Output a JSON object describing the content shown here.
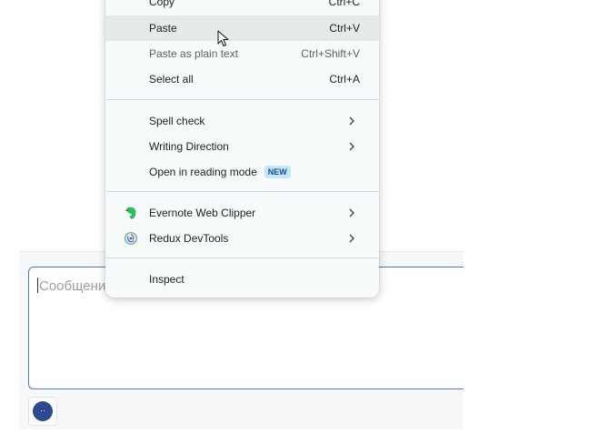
{
  "composer": {
    "placeholder": "Сообщени",
    "emoji_button_glyph": "··"
  },
  "context_menu": {
    "copy": {
      "label": "Copy",
      "shortcut": "Ctrl+C"
    },
    "paste": {
      "label": "Paste",
      "shortcut": "Ctrl+V"
    },
    "paste_plain": {
      "label": "Paste as plain text",
      "shortcut": "Ctrl+Shift+V"
    },
    "select_all": {
      "label": "Select all",
      "shortcut": "Ctrl+A"
    },
    "spell_check": {
      "label": "Spell check"
    },
    "writing_direction": {
      "label": "Writing Direction"
    },
    "reading_mode": {
      "label": "Open in reading mode",
      "badge": "NEW"
    },
    "evernote": {
      "label": "Evernote Web Clipper",
      "icon": "evernote-elephant-icon"
    },
    "redux": {
      "label": "Redux DevTools",
      "icon": "redux-devtools-icon"
    },
    "inspect": {
      "label": "Inspect"
    }
  },
  "colors": {
    "menu_background": "#f7fbfb",
    "highlight": "#e6eaeb",
    "separator": "#c7e3ea",
    "badge_background": "#c5e6f7",
    "badge_text": "#1a4f8b",
    "input_border": "#4a78d6",
    "emoji_button": "#2c4a8e",
    "evernote_green": "#2dbe60",
    "redux_purple": "#764abc"
  }
}
